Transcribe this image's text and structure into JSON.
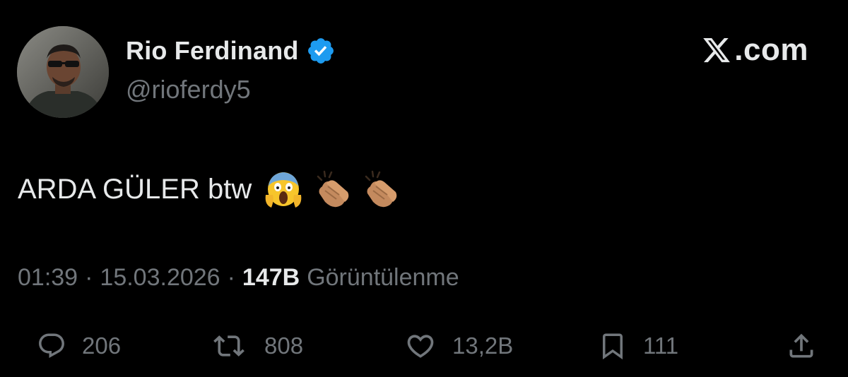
{
  "author": {
    "display_name": "Rio Ferdinand",
    "handle": "@rioferdy5",
    "verified": true,
    "verified_color": "#1d9bf0",
    "avatar_icon": "profile-photo"
  },
  "brand": {
    "text": ".com",
    "logo_icon": "x-logo-icon"
  },
  "tweet": {
    "text": "ARDA GÜLER btw",
    "emojis": [
      "face-screaming-in-fear",
      "clapping-hands-medium-skin",
      "clapping-hands-medium-skin"
    ]
  },
  "meta": {
    "time": "01:39",
    "separator": "·",
    "date": "15.03.2026",
    "views_count": "147B",
    "views_label": "Görüntülenme"
  },
  "actions": {
    "reply": {
      "icon": "reply-bubble-icon",
      "count": "206"
    },
    "repost": {
      "icon": "repost-icon",
      "count": "808"
    },
    "like": {
      "icon": "heart-icon",
      "count": "13,2B"
    },
    "bookmark": {
      "icon": "bookmark-icon",
      "count": "111"
    },
    "share": {
      "icon": "share-upload-icon"
    }
  },
  "colors": {
    "background": "#000000",
    "primary_text": "#e7e9ea",
    "secondary_text": "#71767b"
  }
}
